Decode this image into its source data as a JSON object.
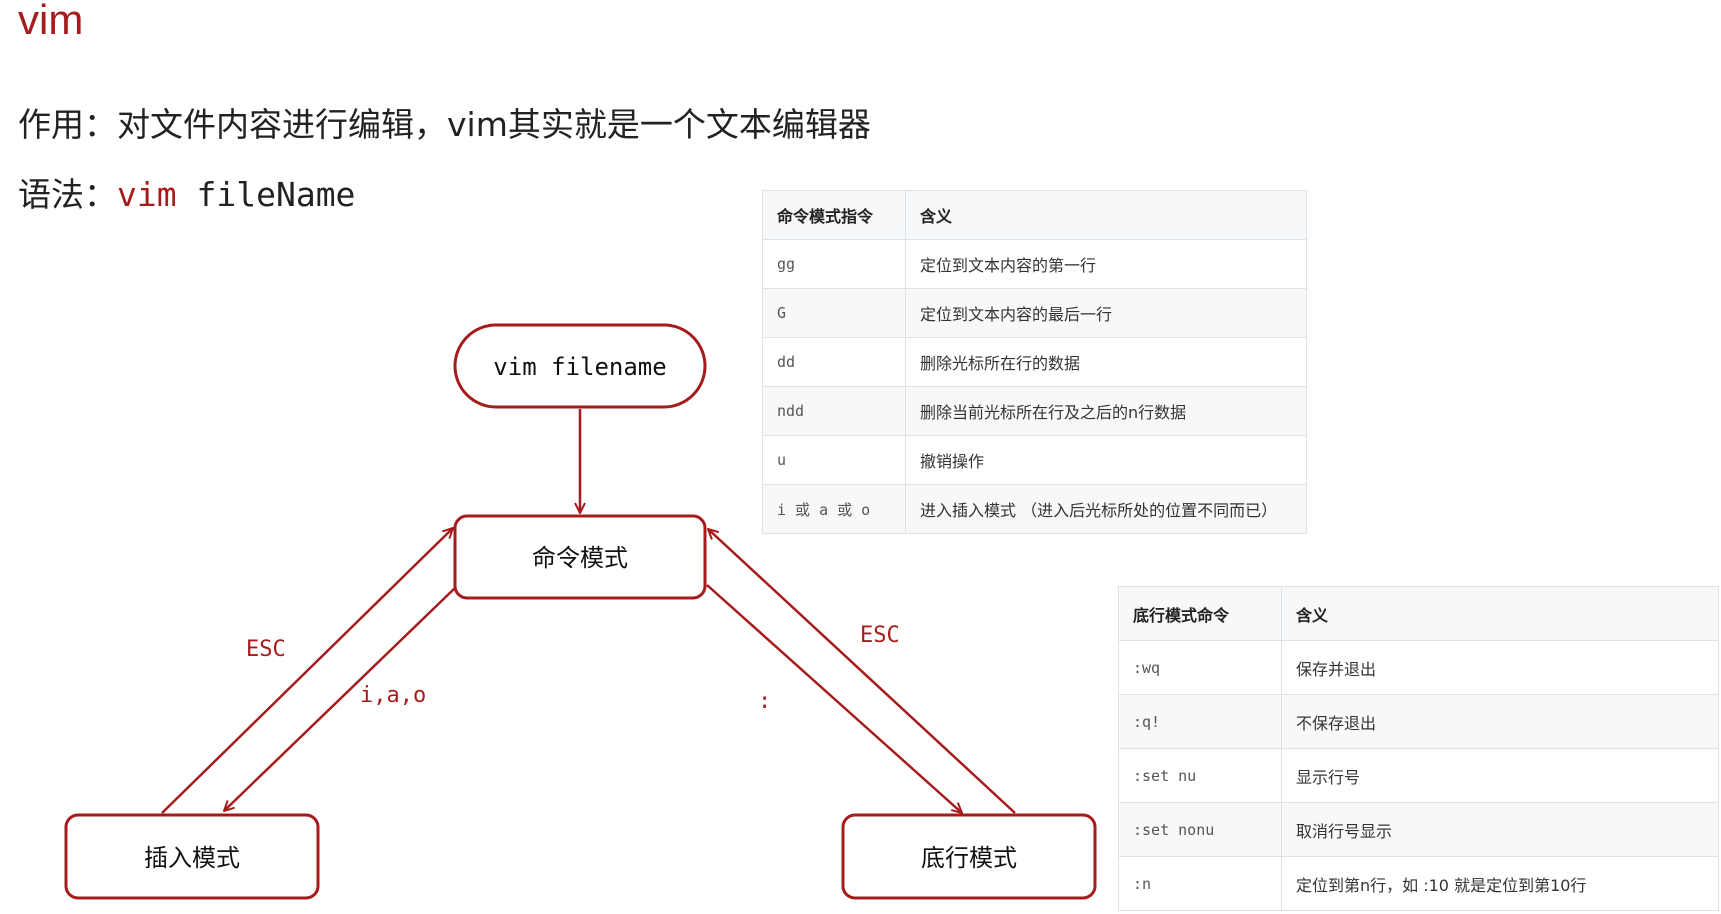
{
  "title": "vim",
  "purpose": {
    "label": "作用：",
    "text": "对文件内容进行编辑，vim其实就是一个文本编辑器"
  },
  "syntax": {
    "label": "语法：",
    "command": "vim",
    "argument": "fileName"
  },
  "diagram": {
    "nodes": {
      "start": "vim filename",
      "command_mode": "命令模式",
      "insert_mode": "插入模式",
      "bottom_mode": "底行模式"
    },
    "edges": {
      "insert_to_command": "ESC",
      "command_to_insert": "i,a,o",
      "command_to_bottom": ":",
      "bottom_to_command": "ESC"
    },
    "colors": {
      "accent": "#a61c1c"
    }
  },
  "command_table": {
    "headers": [
      "命令模式指令",
      "含义"
    ],
    "rows": [
      [
        "gg",
        "定位到文本内容的第一行"
      ],
      [
        "G",
        "定位到文本内容的最后一行"
      ],
      [
        "dd",
        "删除光标所在行的数据"
      ],
      [
        "ndd",
        "删除当前光标所在行及之后的n行数据"
      ],
      [
        "u",
        "撤销操作"
      ],
      [
        "i 或 a 或 o",
        "进入插入模式 （进入后光标所处的位置不同而已）"
      ]
    ]
  },
  "bottom_table": {
    "headers": [
      "底行模式命令",
      "含义"
    ],
    "rows": [
      [
        ":wq",
        "保存并退出"
      ],
      [
        ":q!",
        "不保存退出"
      ],
      [
        ":set nu",
        "显示行号"
      ],
      [
        ":set nonu",
        "取消行号显示"
      ],
      [
        ":n",
        "定位到第n行，如 :10 就是定位到第10行"
      ]
    ]
  }
}
